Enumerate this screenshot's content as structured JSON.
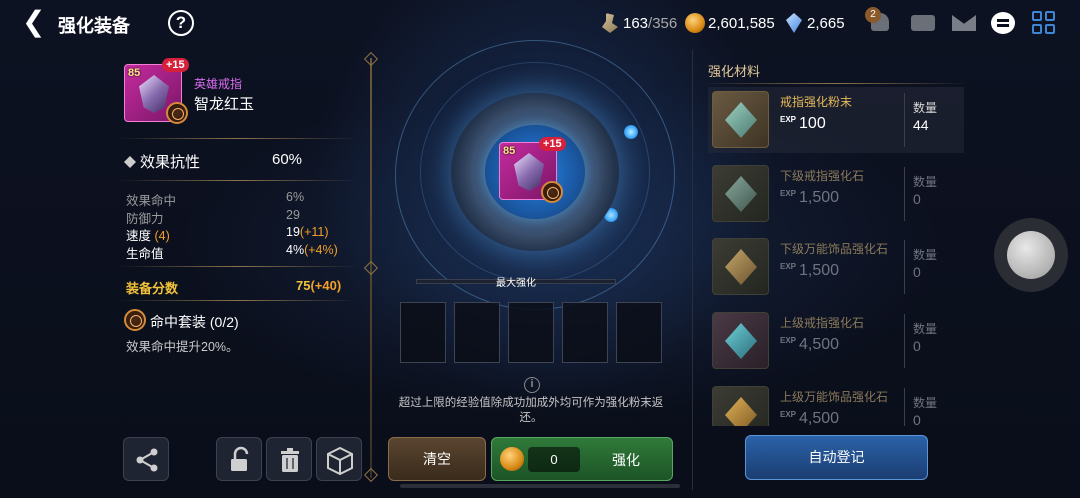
{
  "header": {
    "title": "强化装备",
    "help": "?",
    "stamina": "163",
    "stamina_max": "/356",
    "gold": "2,601,585",
    "crystal": "2,665",
    "notification_count": "2"
  },
  "item": {
    "level": "85",
    "plus": "+15",
    "type": "英雄戒指",
    "name": "智龙红玉",
    "main_stat_name": "效果抗性",
    "main_stat_value": "60%",
    "sub_stats": [
      {
        "name": "效果命中",
        "roll": "",
        "value": "6%",
        "bonus": ""
      },
      {
        "name": "防御力",
        "roll": "",
        "value": "29",
        "bonus": ""
      },
      {
        "name": "速度",
        "roll": "(4)",
        "value": "19",
        "bonus": "(+11)"
      },
      {
        "name": "生命值",
        "roll": "",
        "value": "4%",
        "bonus": "(+4%)"
      }
    ],
    "score_label": "装备分数",
    "score_value": "75",
    "score_bonus": "(+40)",
    "set_name": "命中套装",
    "set_progress": "(0/2)",
    "set_desc": "效果命中提升20%。"
  },
  "enhance": {
    "max_label": "最大强化",
    "note": "超过上限的经验值除成功加成外均可作为强化粉末返还。",
    "clear_label": "清空",
    "cost": "0",
    "enhance_label": "强化"
  },
  "materials": {
    "title": "强化材料",
    "count_label": "数量",
    "exp_tag": "EXP",
    "items": [
      {
        "name": "戒指强化粉末",
        "exp": "100",
        "count": "44"
      },
      {
        "name": "下级戒指强化石",
        "exp": "1,500",
        "count": "0"
      },
      {
        "name": "下级万能饰品强化石",
        "exp": "1,500",
        "count": "0"
      },
      {
        "name": "上级戒指强化石",
        "exp": "4,500",
        "count": "0"
      },
      {
        "name": "上级万能饰品强化石",
        "exp": "4,500",
        "count": "0"
      }
    ],
    "auto_label": "自动登记"
  }
}
